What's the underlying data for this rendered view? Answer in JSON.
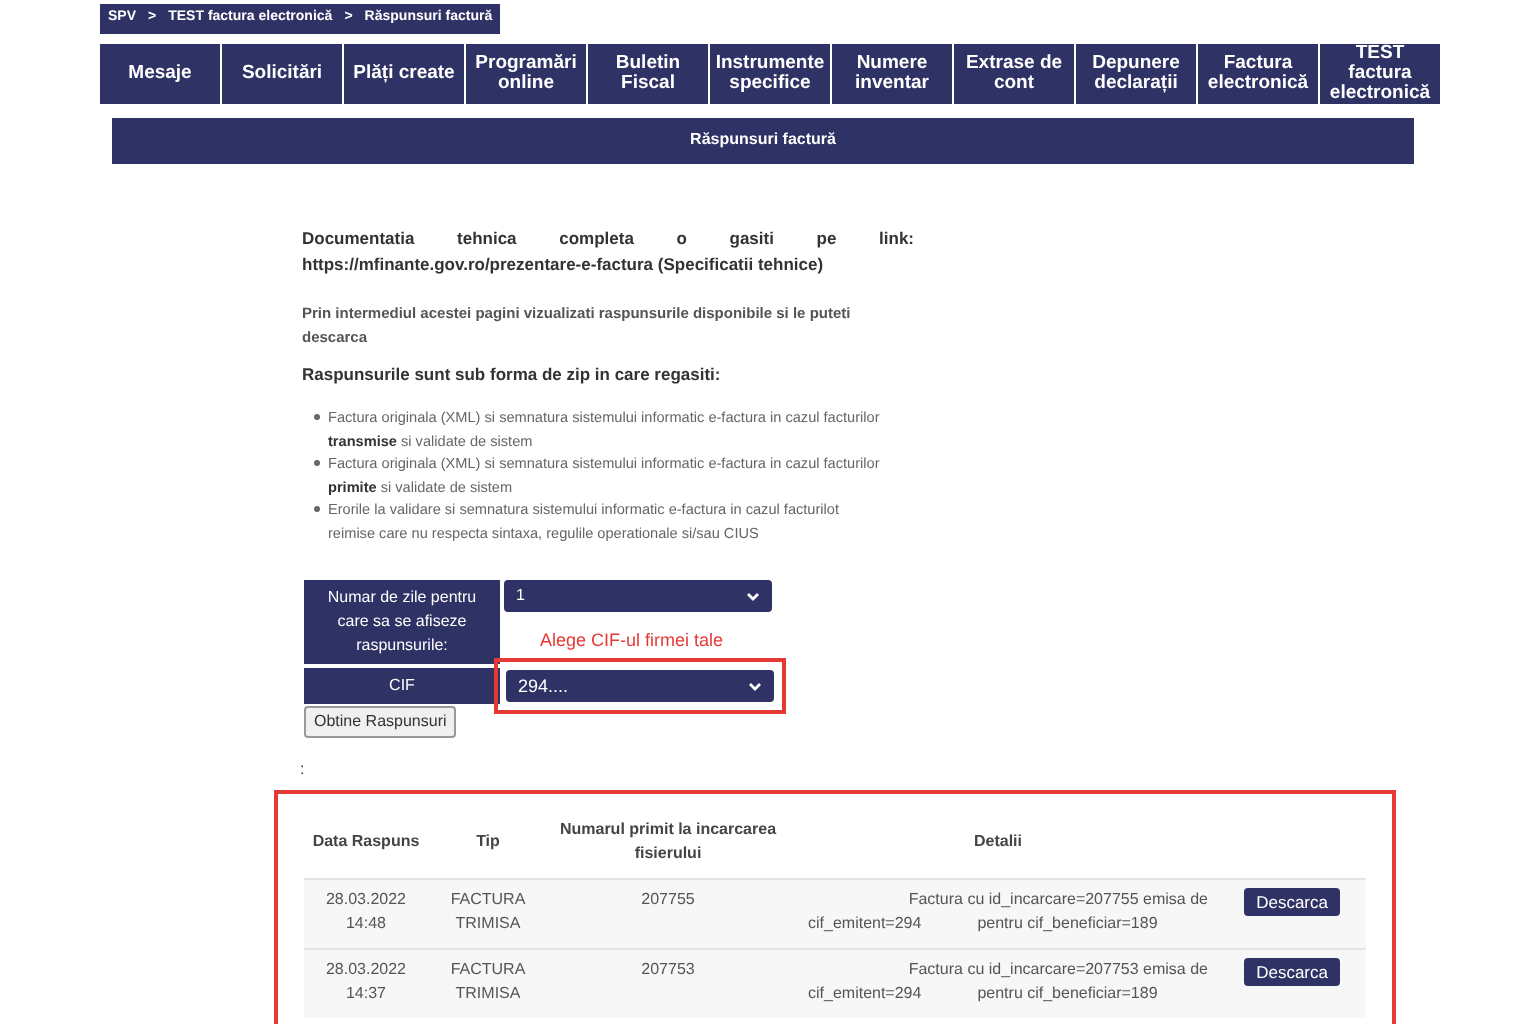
{
  "breadcrumb": [
    "SPV",
    ">",
    "TEST factura electronică",
    ">",
    "Răspunsuri factură"
  ],
  "nav": [
    {
      "label": "Mesaje"
    },
    {
      "label": "Solicitări"
    },
    {
      "label": "Plăți create"
    },
    {
      "label": "Programări online"
    },
    {
      "label": "Buletin Fiscal"
    },
    {
      "label": "Instrumente specifice"
    },
    {
      "label": "Numere inventar"
    },
    {
      "label": "Extrase de cont"
    },
    {
      "label": "Depunere declarații"
    },
    {
      "label": "Factura electronică"
    },
    {
      "label": "TEST factura electronică"
    }
  ],
  "page_title": "Răspunsuri factură",
  "doc_text": "Documentatia tehnica completa o gasiti pe link: https://mfinante.gov.ro/prezentare-e-factura (Specificatii tehnice)",
  "intro": "Prin intermediul acestei pagini vizualizati raspunsurile disponibile si le puteti descarca",
  "list_heading": "Raspunsurile sunt sub forma de zip in care regasiti:",
  "bullets": [
    "Factura originala (XML) si semnatura sistemului informatic e-factura in cazul facturilor **transmise** si validate de sistem",
    "Factura originala (XML) si semnatura sistemului informatic e-factura in cazul facturilor **primite** si validate de sistem",
    "Erorile la validare si semnatura sistemului informatic e-factura in cazul facturilot reimise care nu respecta sintaxa, regulile operationale si/sau CIUS"
  ],
  "form": {
    "days_label": "Numar de zile pentru care sa se afiseze raspunsurile:",
    "days_value": "1",
    "hint": "Alege CIF-ul firmei tale",
    "cif_label": "CIF",
    "cif_value": "294....",
    "submit": "Obtine Raspunsuri",
    "separator": ":"
  },
  "table": {
    "columns": [
      "Data Raspuns",
      "Tip",
      "Numarul primit la incarcarea fisierului",
      "Detalii"
    ],
    "rows": [
      {
        "date": "28.03.2022",
        "time": "14:48",
        "type": [
          "FACTURA",
          "TRIMISA"
        ],
        "number": "207755",
        "details": "Factura cu id_incarcare=207755 emisa de",
        "emitent": "cif_emitent=294",
        "beneficiar": "pentru cif_beneficiar=189",
        "action": "Descarca"
      },
      {
        "date": "28.03.2022",
        "time": "14:37",
        "type": [
          "FACTURA",
          "TRIMISA"
        ],
        "number": "207753",
        "details": "Factura cu id_incarcare=207753 emisa de",
        "emitent": "cif_emitent=294",
        "beneficiar": "pentru cif_beneficiar=189",
        "action": "Descarca"
      }
    ]
  }
}
